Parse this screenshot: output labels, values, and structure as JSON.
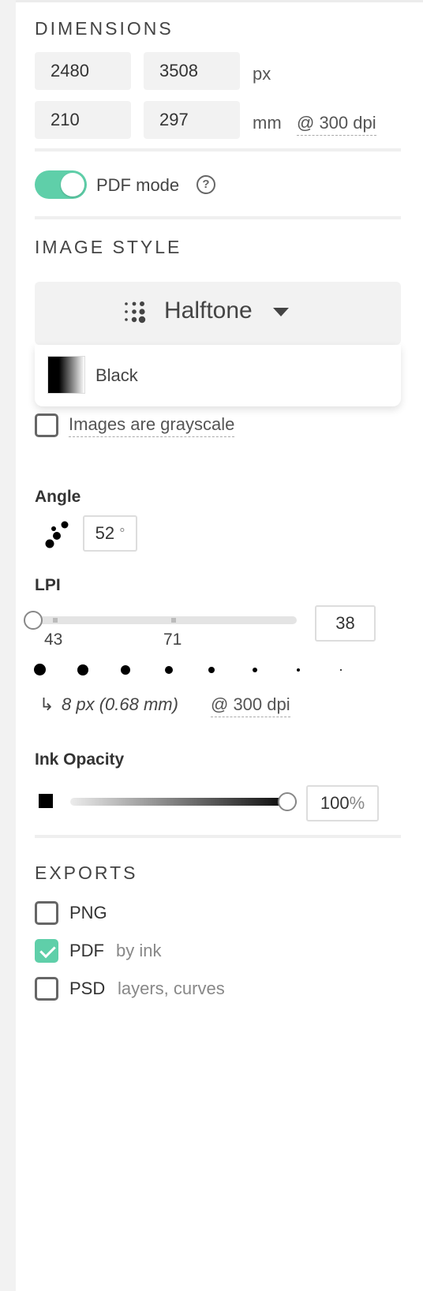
{
  "dimensions": {
    "title": "DIMENSIONS",
    "width_px": "2480",
    "height_px": "3508",
    "px_unit": "px",
    "width_mm": "210",
    "height_mm": "297",
    "mm_unit": "mm",
    "dpi_link": "@ 300 dpi"
  },
  "pdf_mode": {
    "label": "PDF mode",
    "enabled": true,
    "help": "?"
  },
  "image_style": {
    "title": "IMAGE STYLE",
    "selected": "Halftone",
    "dropdown_item": "Black",
    "grayscale_label": "Images are grayscale",
    "grayscale_checked": false
  },
  "angle": {
    "label": "Angle",
    "value": "52",
    "unit": "°"
  },
  "lpi": {
    "label": "LPI",
    "value": "38",
    "tick_labels": [
      "43",
      "71"
    ],
    "note": "8 px (0.68 mm)",
    "note_arrow": "↳",
    "dpi_link": "@ 300 dpi"
  },
  "ink_opacity": {
    "label": "Ink Opacity",
    "value": "100",
    "unit": "%",
    "level_percent": 100
  },
  "exports": {
    "title": "EXPORTS",
    "items": [
      {
        "label": "PNG",
        "sub": "",
        "checked": false
      },
      {
        "label": "PDF",
        "sub": "by ink",
        "checked": true
      },
      {
        "label": "PSD",
        "sub": "layers, curves",
        "checked": false
      }
    ]
  },
  "colors": {
    "accent": "#5fcfa9"
  }
}
